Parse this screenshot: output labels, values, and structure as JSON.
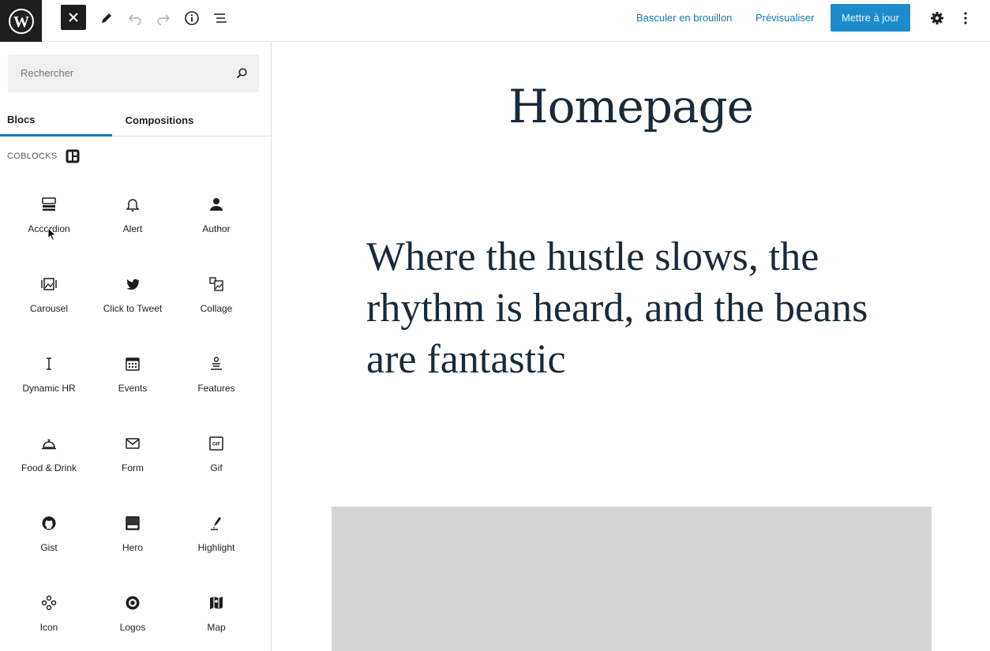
{
  "toolbar": {
    "switch_to_draft": "Basculer en brouillon",
    "preview": "Prévisualiser",
    "update": "Mettre à jour"
  },
  "search": {
    "placeholder": "Rechercher"
  },
  "tabs": [
    {
      "label": "Blocs",
      "active": true
    },
    {
      "label": "Compositions",
      "active": false
    }
  ],
  "category": {
    "label": "COBLOCKS"
  },
  "blocks": [
    {
      "label": "Accordion",
      "icon": "accordion-icon"
    },
    {
      "label": "Alert",
      "icon": "bell-icon"
    },
    {
      "label": "Author",
      "icon": "person-icon"
    },
    {
      "label": "Carousel",
      "icon": "carousel-icon"
    },
    {
      "label": "Click to Tweet",
      "icon": "twitter-icon"
    },
    {
      "label": "Collage",
      "icon": "collage-icon"
    },
    {
      "label": "Dynamic HR",
      "icon": "dynamic-hr-icon"
    },
    {
      "label": "Events",
      "icon": "calendar-icon"
    },
    {
      "label": "Features",
      "icon": "features-icon"
    },
    {
      "label": "Food & Drink",
      "icon": "cloche-icon"
    },
    {
      "label": "Form",
      "icon": "envelope-icon"
    },
    {
      "label": "Gif",
      "icon": "gif-icon"
    },
    {
      "label": "Gist",
      "icon": "github-icon"
    },
    {
      "label": "Hero",
      "icon": "hero-icon"
    },
    {
      "label": "Highlight",
      "icon": "highlighter-icon"
    },
    {
      "label": "Icon",
      "icon": "icon-block-icon"
    },
    {
      "label": "Logos",
      "icon": "logos-icon"
    },
    {
      "label": "Map",
      "icon": "map-icon"
    }
  ],
  "editor": {
    "title": "Homepage",
    "heading": "Where the hustle slows, the rhythm is heard, and the beans are fantastic"
  },
  "colors": {
    "accent": "#0a7bb3",
    "update_button": "#1e8ccc",
    "title_text": "#192a3a",
    "cover_placeholder": "#d6d6d6"
  }
}
